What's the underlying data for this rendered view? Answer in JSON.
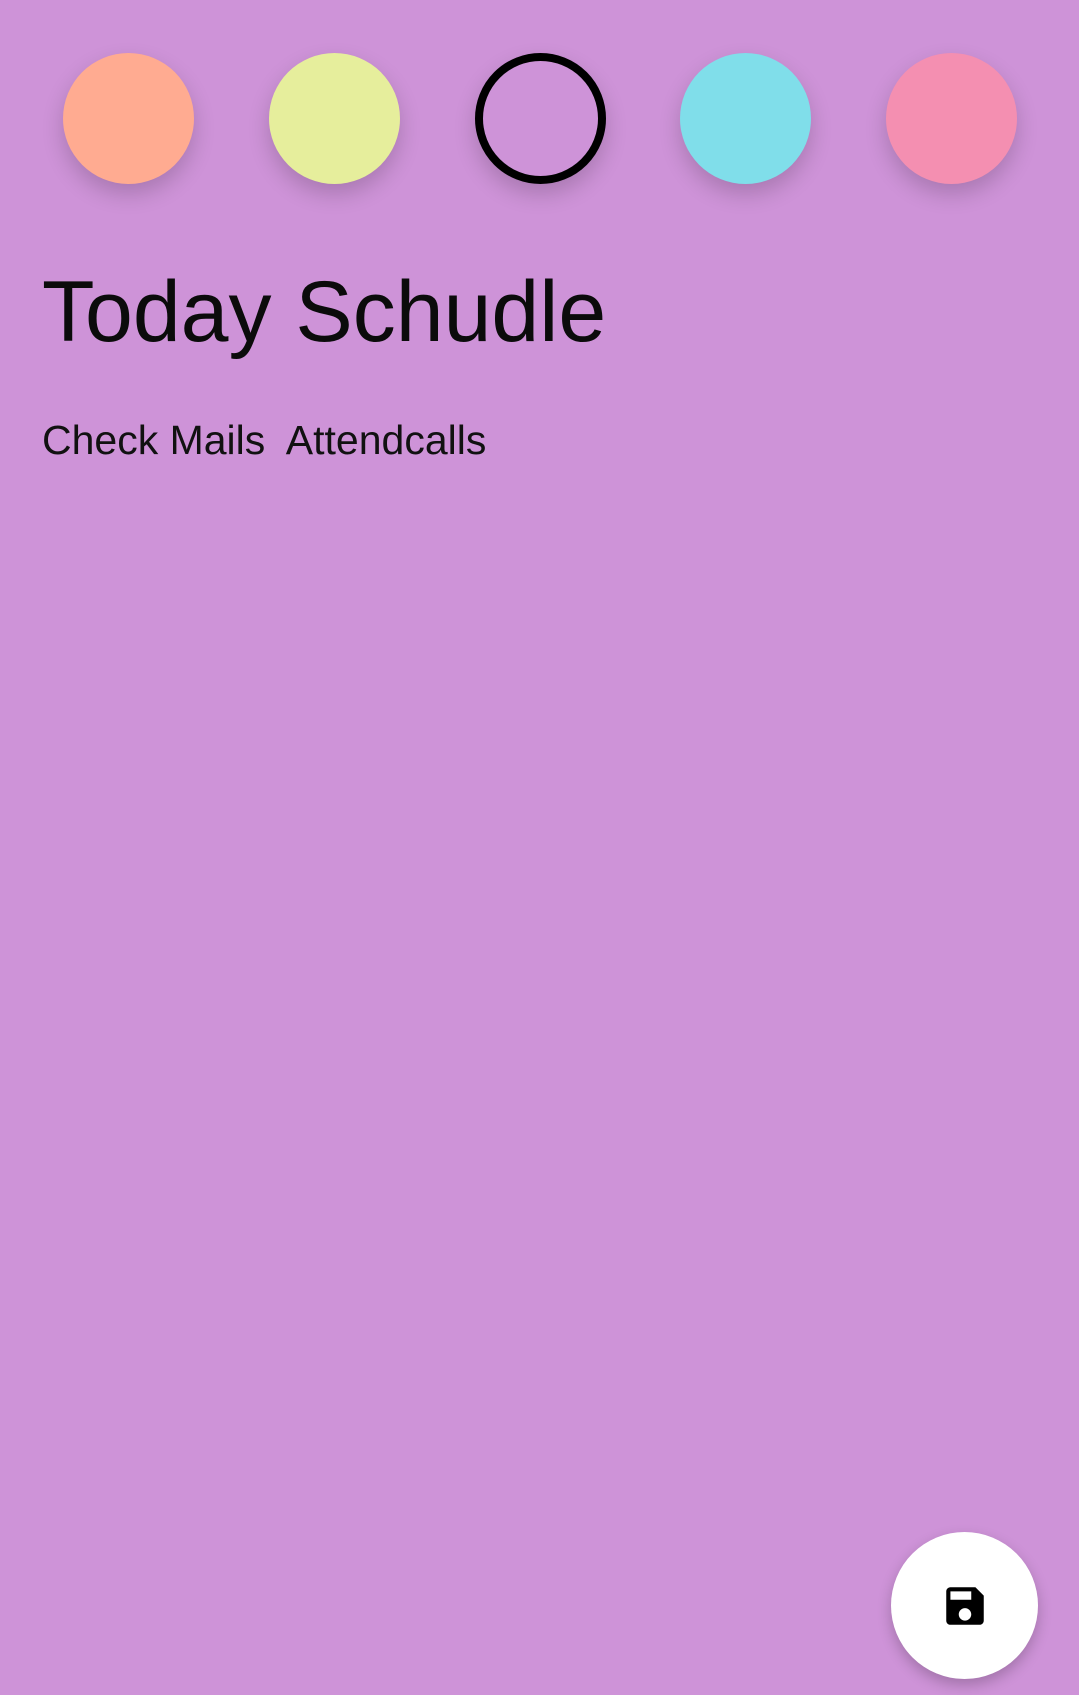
{
  "theme": {
    "background": "#ce93d8"
  },
  "color_picker": {
    "selected_index": 2,
    "swatches": [
      {
        "name": "peach",
        "color": "#ffab91"
      },
      {
        "name": "lime",
        "color": "#e6ee9c"
      },
      {
        "name": "purple",
        "color": "#ce93d8"
      },
      {
        "name": "cyan",
        "color": "#80deea"
      },
      {
        "name": "pink",
        "color": "#f48fb1"
      }
    ]
  },
  "note": {
    "title": "Today Schudle",
    "body": "Check Mails  Attendcalls"
  },
  "fab": {
    "icon": "save-icon"
  }
}
